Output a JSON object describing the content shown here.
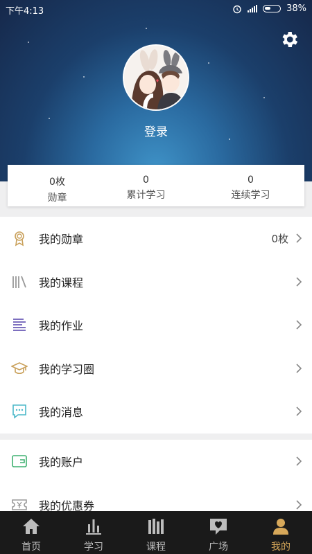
{
  "status_bar": {
    "time": "下午4:13",
    "battery": "38%"
  },
  "profile": {
    "login_label": "登录"
  },
  "stats": [
    {
      "value": "0枚",
      "label": "勋章"
    },
    {
      "value": "0",
      "label": "累计学习"
    },
    {
      "value": "0",
      "label": "连续学习"
    }
  ],
  "menu": {
    "medals": {
      "label": "我的勋章",
      "value": "0枚"
    },
    "courses": {
      "label": "我的课程"
    },
    "homework": {
      "label": "我的作业"
    },
    "circle": {
      "label": "我的学习圈"
    },
    "messages": {
      "label": "我的消息"
    },
    "account": {
      "label": "我的账户"
    },
    "coupons": {
      "label": "我的优惠券"
    }
  },
  "tabs": [
    {
      "label": "首页"
    },
    {
      "label": "学习"
    },
    {
      "label": "课程"
    },
    {
      "label": "广场"
    },
    {
      "label": "我的"
    }
  ],
  "colors": {
    "accent": "#d7a85a",
    "tabbar_bg": "#1a1a1a"
  }
}
